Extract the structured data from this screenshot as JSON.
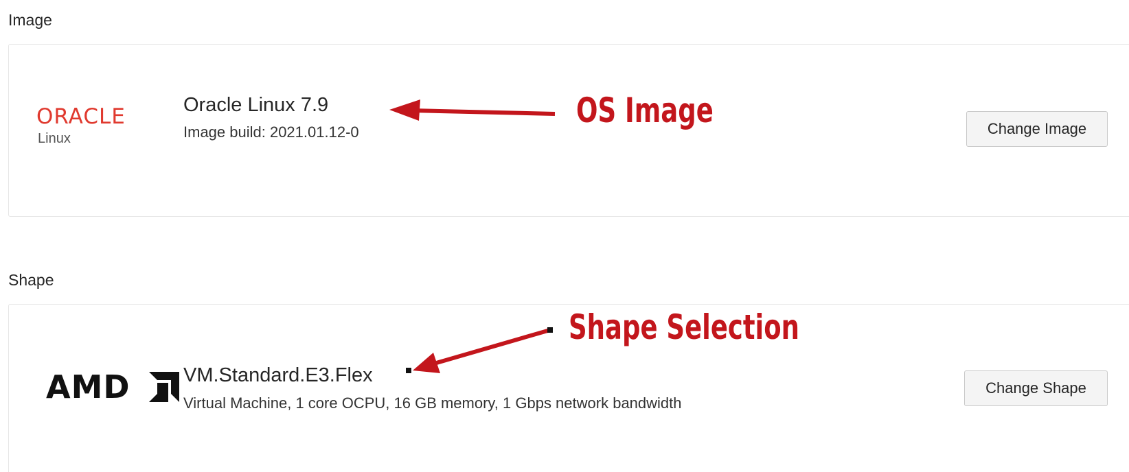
{
  "image_section": {
    "label": "Image",
    "logo_word": "ORACLE",
    "logo_sub": "Linux",
    "title": "Oracle Linux 7.9",
    "subtitle": "Image build: 2021.01.12-0",
    "button_label": "Change Image"
  },
  "shape_section": {
    "label": "Shape",
    "logo_word": "AMD",
    "title": "VM.Standard.E3.Flex",
    "subtitle": "Virtual Machine, 1 core OCPU, 16 GB memory, 1 Gbps network bandwidth",
    "button_label": "Change Shape"
  },
  "annotations": {
    "os_image": "OS Image",
    "shape_selection": "Shape Selection"
  },
  "colors": {
    "annotation_red": "#c3161c",
    "oracle_red": "#e03a2f",
    "button_bg": "#f4f4f4",
    "card_border": "#e6e6e6"
  },
  "icons": {
    "oracle_logo": "oracle-linux-logo",
    "amd_logo": "amd-logo",
    "arrow": "red-arrow"
  }
}
